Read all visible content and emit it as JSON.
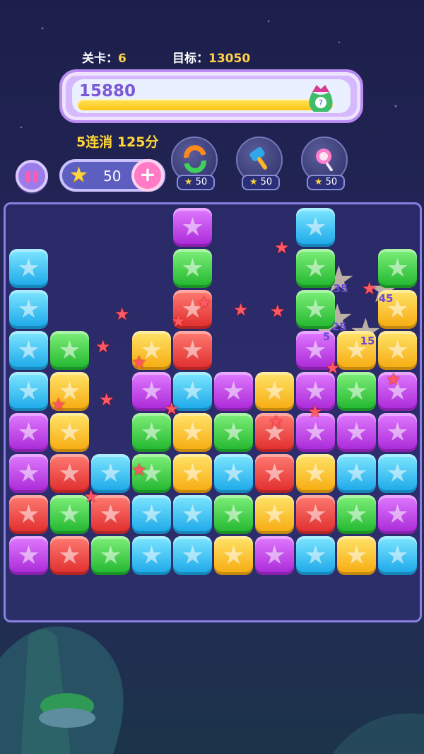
{
  "hud": {
    "level_label": "关卡：",
    "level_value": "6",
    "target_label": "目标：",
    "target_value": "13050",
    "score": "15880",
    "progress": 0.95,
    "combo_text": "5连消 125分",
    "coins": "50"
  },
  "tools": [
    {
      "name": "refresh",
      "cost": "50"
    },
    {
      "name": "hammer",
      "cost": "50"
    },
    {
      "name": "candy",
      "cost": "50"
    }
  ],
  "colors": {
    "blue": "#18a6e8",
    "green": "#1fb52d",
    "purple": "#a826d6",
    "yellow": "#f6a90d",
    "red": "#df2b2b",
    "accent": "#ffd24a"
  },
  "board": {
    "columns": 10,
    "rows": 9,
    "grid": [
      [
        "",
        "",
        "",
        "",
        "purple",
        "",
        "",
        "blue",
        "",
        ""
      ],
      [
        "blue",
        "",
        "",
        "",
        "green",
        "",
        "",
        "green",
        "",
        "green"
      ],
      [
        "blue",
        "",
        "",
        "",
        "red",
        "",
        "",
        "green",
        "",
        "yellow"
      ],
      [
        "blue",
        "green",
        "",
        "yellow",
        "red",
        "",
        "",
        "purple",
        "yellow",
        "yellow"
      ],
      [
        "blue",
        "yellow",
        "",
        "purple",
        "blue",
        "purple",
        "yellow",
        "purple",
        "green",
        "purple"
      ],
      [
        "purple",
        "yellow",
        "",
        "green",
        "yellow",
        "green",
        "red",
        "purple",
        "purple",
        "purple"
      ],
      [
        "purple",
        "red",
        "blue",
        "green",
        "yellow",
        "blue",
        "red",
        "yellow",
        "blue",
        "blue"
      ],
      [
        "red",
        "green",
        "red",
        "blue",
        "blue",
        "green",
        "yellow",
        "red",
        "green",
        "purple"
      ],
      [
        "purple",
        "red",
        "green",
        "blue",
        "blue",
        "yellow",
        "purple",
        "blue",
        "yellow",
        "blue"
      ]
    ]
  },
  "bonus_points": [
    "35",
    "45",
    "25",
    "5",
    "15"
  ]
}
